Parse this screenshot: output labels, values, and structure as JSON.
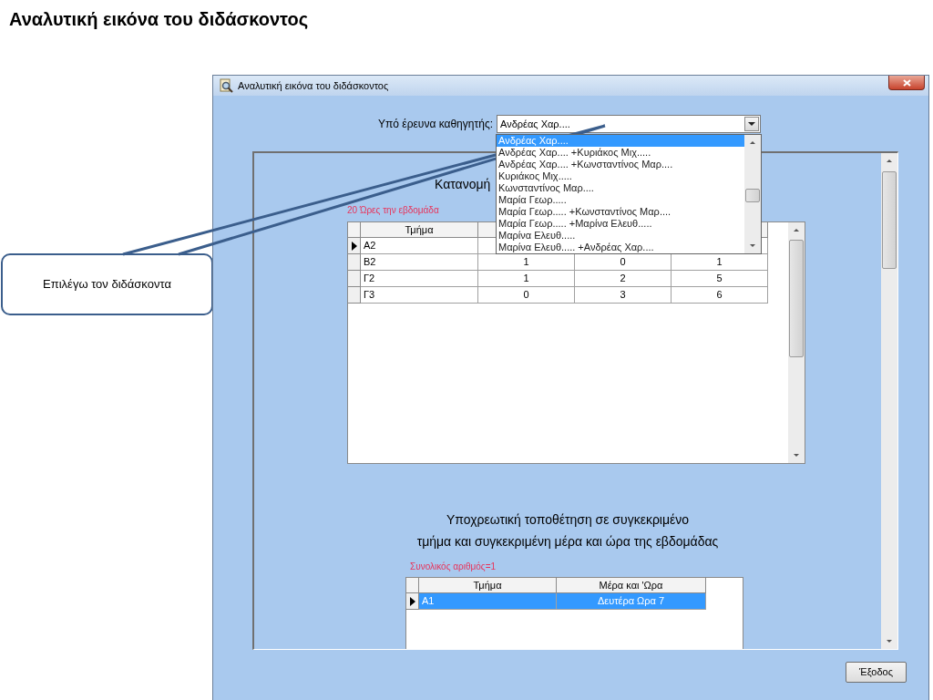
{
  "slide_title": "Αναλυτική εικόνα του διδάσκοντος",
  "callout": {
    "text": "Επιλέγω τον διδάσκοντα"
  },
  "window": {
    "title": "Αναλυτική εικόνα του διδάσκοντος"
  },
  "teacher_select": {
    "label": "Υπό έρευνα καθηγητής:",
    "value": "Ανδρέας Χαρ....",
    "expanded": true,
    "options": [
      {
        "label": "Ανδρέας Χαρ....",
        "selected": true
      },
      {
        "label": "Ανδρέας Χαρ.... +Κυριάκος Μιχ.....",
        "selected": false
      },
      {
        "label": "Ανδρέας Χαρ.... +Κωνσταντίνος Μαρ....",
        "selected": false
      },
      {
        "label": "Κυριάκος Μιχ.....",
        "selected": false
      },
      {
        "label": "Κωνσταντίνος Μαρ....",
        "selected": false
      },
      {
        "label": "Μαρία Γεωρ.....",
        "selected": false
      },
      {
        "label": "Μαρία Γεωρ..... +Κωνσταντίνος Μαρ....",
        "selected": false
      },
      {
        "label": "Μαρία Γεωρ..... +Μαρίνα Ελευθ.....",
        "selected": false
      },
      {
        "label": "Μαρίνα Ελευθ.....",
        "selected": false
      },
      {
        "label": "Μαρίνα Ελευθ..... +Ανδρέας Χαρ....",
        "selected": false
      }
    ]
  },
  "distribution": {
    "heading": "Κατανομή",
    "hours_note": "20 Ώρες την εβδομάδα",
    "columns": [
      "Τμήμα"
    ],
    "rows": [
      {
        "cells": [
          "Α2"
        ],
        "current": true
      },
      {
        "cells": [
          "Β2",
          "1",
          "0",
          "1"
        ],
        "current": false
      },
      {
        "cells": [
          "Γ2",
          "1",
          "2",
          "5"
        ],
        "current": false
      },
      {
        "cells": [
          "Γ3",
          "0",
          "3",
          "6"
        ],
        "current": false
      }
    ]
  },
  "placement": {
    "heading_lines": [
      "Υποχρεωτική τοποθέτηση σε συγκεκριμένο",
      "τμήμα και συγκεκριμένη μέρα και ώρα της εβδομάδας"
    ],
    "total": "Συνολικός αριθμός=1",
    "columns": [
      "Τμήμα",
      "Μέρα και 'Ωρα"
    ],
    "rows": [
      {
        "cells": [
          "Α1",
          "Δευτέρα Ωρα 7"
        ],
        "current": true,
        "selected": true
      }
    ]
  },
  "exit_button": "Έξοδος"
}
